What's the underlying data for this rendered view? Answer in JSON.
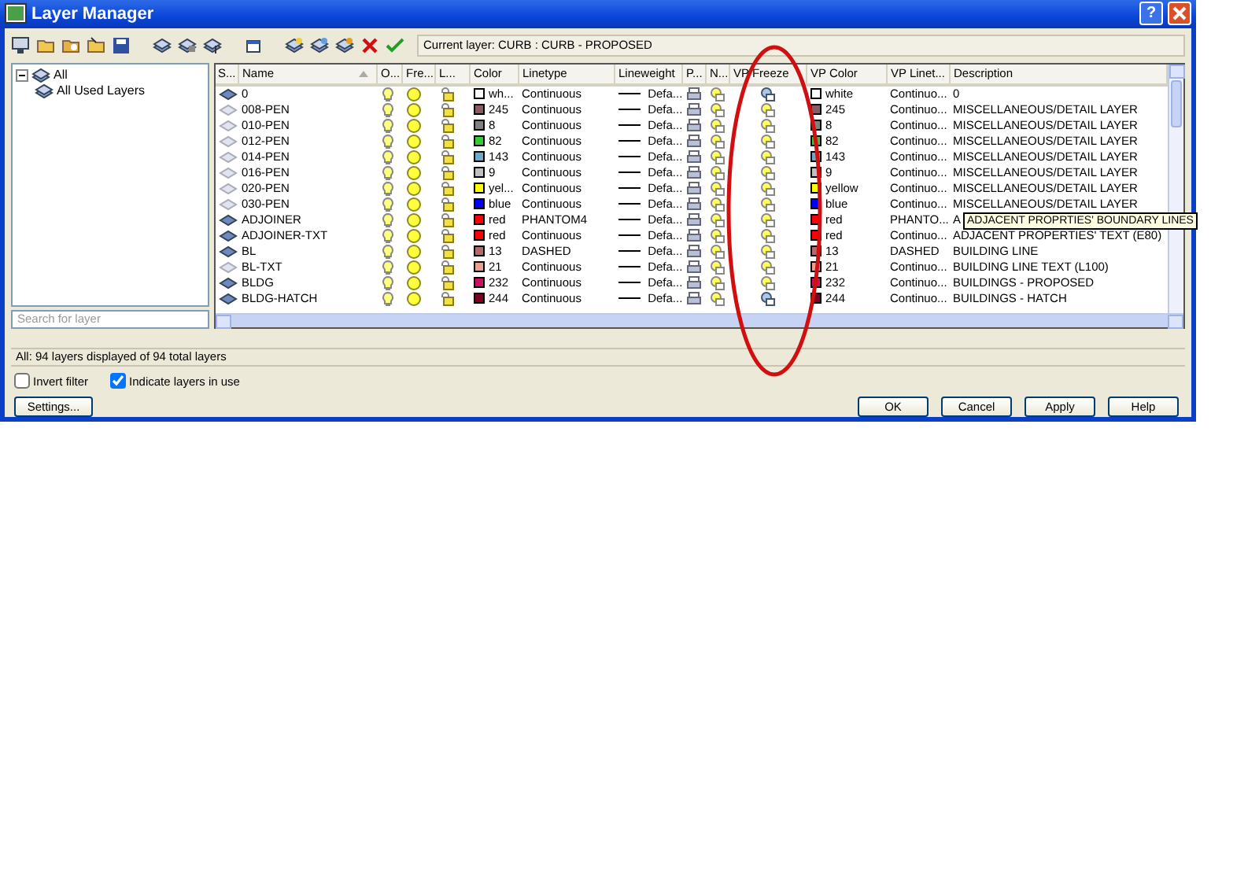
{
  "window": {
    "title": "Layer Manager",
    "help_button": "?"
  },
  "toolbar": {
    "current_layer": "Current layer: CURB : CURB - PROPOSED"
  },
  "tree": [
    {
      "label": "All",
      "expanded": true,
      "children": [
        {
          "label": "All Used Layers"
        }
      ]
    }
  ],
  "search": {
    "placeholder": "Search for layer"
  },
  "table": {
    "columns": [
      {
        "label": "S...",
        "sorted": false
      },
      {
        "label": "Name",
        "sorted": true
      },
      {
        "label": "O...",
        "sorted": false
      },
      {
        "label": "Fre...",
        "sorted": false
      },
      {
        "label": "L...",
        "sorted": false
      },
      {
        "label": "Color",
        "sorted": false
      },
      {
        "label": "Linetype",
        "sorted": false
      },
      {
        "label": "Lineweight",
        "sorted": false
      },
      {
        "label": "P...",
        "sorted": false
      },
      {
        "label": "N...",
        "sorted": false
      },
      {
        "label": "VP Freeze",
        "sorted": false
      },
      {
        "label": "VP Color",
        "sorted": false
      },
      {
        "label": "VP Linet...",
        "sorted": false
      },
      {
        "label": "Description",
        "sorted": false
      }
    ],
    "rows": [
      {
        "in_use": true,
        "name": "0",
        "color": "#ffffff",
        "color_label": "wh...",
        "linetype": "Continuous",
        "lineweight": "Defa...",
        "vp_frozen": true,
        "vp_color_label": "white",
        "vp_linetype": "Continuo...",
        "description": "0"
      },
      {
        "in_use": false,
        "name": "008-PEN",
        "color": "#8b5a62",
        "color_label": "245",
        "linetype": "Continuous",
        "lineweight": "Defa...",
        "vp_frozen": false,
        "vp_color_label": "245",
        "vp_linetype": "Continuo...",
        "description": "MISCELLANEOUS/DETAIL LAYER"
      },
      {
        "in_use": false,
        "name": "010-PEN",
        "color": "#808080",
        "color_label": "8",
        "linetype": "Continuous",
        "lineweight": "Defa...",
        "vp_frozen": false,
        "vp_color_label": "8",
        "vp_linetype": "Continuo...",
        "description": "MISCELLANEOUS/DETAIL LAYER"
      },
      {
        "in_use": false,
        "name": "012-PEN",
        "color": "#33cc33",
        "color_label": "82",
        "linetype": "Continuous",
        "lineweight": "Defa...",
        "vp_frozen": false,
        "vp_color_label": "82",
        "vp_linetype": "Continuo...",
        "description": "MISCELLANEOUS/DETAIL LAYER"
      },
      {
        "in_use": false,
        "name": "014-PEN",
        "color": "#6fa8c8",
        "color_label": "143",
        "linetype": "Continuous",
        "lineweight": "Defa...",
        "vp_frozen": false,
        "vp_color_label": "143",
        "vp_linetype": "Continuo...",
        "description": "MISCELLANEOUS/DETAIL LAYER"
      },
      {
        "in_use": false,
        "name": "016-PEN",
        "color": "#c0c0c0",
        "color_label": "9",
        "linetype": "Continuous",
        "lineweight": "Defa...",
        "vp_frozen": false,
        "vp_color_label": "9",
        "vp_linetype": "Continuo...",
        "description": "MISCELLANEOUS/DETAIL LAYER"
      },
      {
        "in_use": false,
        "name": "020-PEN",
        "color": "#ffff00",
        "color_label": "yel...",
        "linetype": "Continuous",
        "lineweight": "Defa...",
        "vp_frozen": false,
        "vp_color_label": "yellow",
        "vp_linetype": "Continuo...",
        "description": "MISCELLANEOUS/DETAIL LAYER"
      },
      {
        "in_use": false,
        "name": "030-PEN",
        "color": "#0000ff",
        "color_label": "blue",
        "linetype": "Continuous",
        "lineweight": "Defa...",
        "vp_frozen": false,
        "vp_color_label": "blue",
        "vp_linetype": "Continuo...",
        "description": "MISCELLANEOUS/DETAIL LAYER"
      },
      {
        "in_use": true,
        "name": "ADJOINER",
        "color": "#ff0000",
        "color_label": "red",
        "linetype": "PHANTOM4",
        "lineweight": "Defa...",
        "vp_frozen": false,
        "vp_color_label": "red",
        "vp_linetype": "PHANTO...",
        "description": "A",
        "tooltip": "ADJACENT PROPRTIES' BOUNDARY LINES"
      },
      {
        "in_use": true,
        "name": "ADJOINER-TXT",
        "color": "#ff0000",
        "color_label": "red",
        "linetype": "Continuous",
        "lineweight": "Defa...",
        "vp_frozen": false,
        "vp_color_label": "red",
        "vp_linetype": "Continuo...",
        "description": "ADJACENT PROPERTIES' TEXT (E80)"
      },
      {
        "in_use": true,
        "name": "BL",
        "color": "#b46a6a",
        "color_label": "13",
        "linetype": "DASHED",
        "lineweight": "Defa...",
        "vp_frozen": false,
        "vp_color_label": "13",
        "vp_linetype": "DASHED",
        "description": "BUILDING LINE"
      },
      {
        "in_use": false,
        "name": "BL-TXT",
        "color": "#e8a090",
        "color_label": "21",
        "linetype": "Continuous",
        "lineweight": "Defa...",
        "vp_frozen": false,
        "vp_color_label": "21",
        "vp_linetype": "Continuo...",
        "description": "BUILDING LINE TEXT (L100)"
      },
      {
        "in_use": true,
        "name": "BLDG",
        "color": "#cc1060",
        "color_label": "232",
        "linetype": "Continuous",
        "lineweight": "Defa...",
        "vp_frozen": false,
        "vp_color_label": "232",
        "vp_linetype": "Continuo...",
        "description": "BUILDINGS - PROPOSED"
      },
      {
        "in_use": true,
        "name": "BLDG-HATCH",
        "color": "#7f0020",
        "color_label": "244",
        "linetype": "Continuous",
        "lineweight": "Defa...",
        "vp_frozen": true,
        "vp_color_label": "244",
        "vp_linetype": "Continuo...",
        "description": "BUILDINGS - HATCH"
      }
    ]
  },
  "status": "All: 94 layers displayed of 94 total layers",
  "options": [
    {
      "label": "Invert filter",
      "checked": false
    },
    {
      "label": "Indicate layers in use",
      "checked": true
    }
  ],
  "settings_button": "Settings...",
  "buttons": [
    "OK",
    "Cancel",
    "Apply",
    "Help"
  ]
}
